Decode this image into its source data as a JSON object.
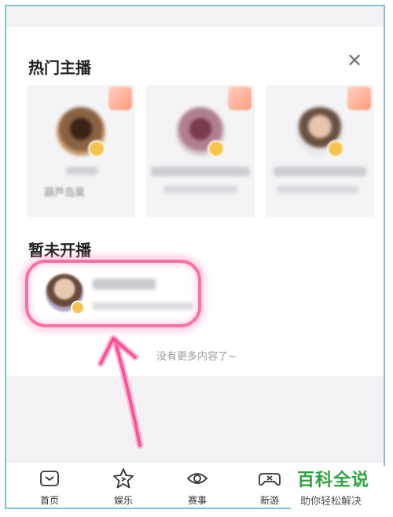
{
  "hot_anchors": {
    "title": "热门主播",
    "cards": [
      {
        "name": "葫芦岛昊",
        "avatar_color": "#6b4a2e"
      },
      {
        "name": "",
        "avatar_color": "#8a5a68"
      },
      {
        "name": "",
        "avatar_color": "#d0b8a8"
      }
    ]
  },
  "offline": {
    "title": "暂未开播"
  },
  "no_more_text": "没有更多内容了~",
  "tabs": [
    {
      "label": "首页",
      "icon": "home-icon"
    },
    {
      "label": "娱乐",
      "icon": "star-icon"
    },
    {
      "label": "赛事",
      "icon": "eye-icon"
    },
    {
      "label": "新游",
      "icon": "gamepad-icon"
    }
  ],
  "watermark": {
    "title": "百科全说",
    "subtitle": "助你轻松解决"
  },
  "colors": {
    "highlight": "#ff6ea6",
    "frame": "#7cc2d8",
    "watermark_green": "#2fa33f"
  }
}
